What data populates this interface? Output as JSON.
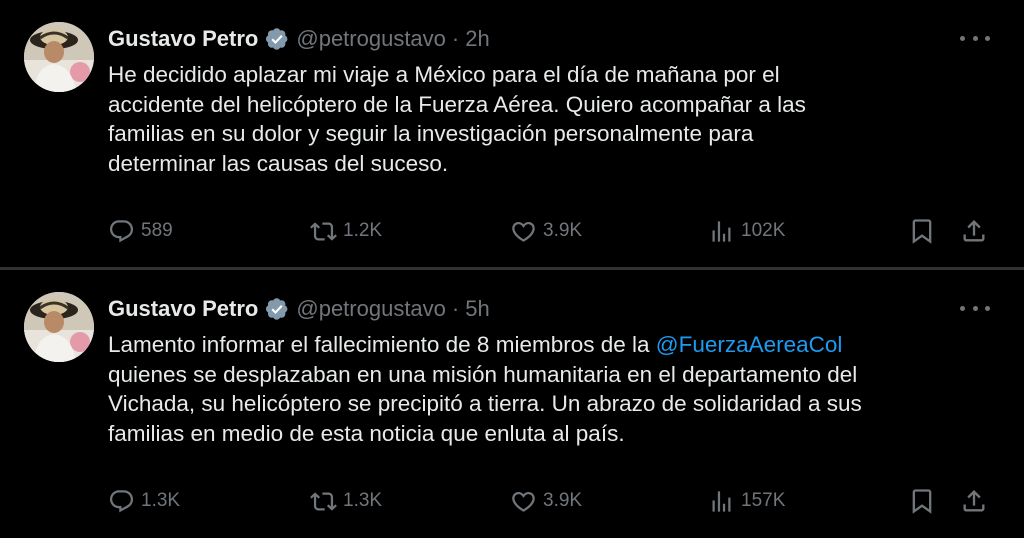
{
  "colors": {
    "background": "#000000",
    "text_primary": "#e7e9ea",
    "text_secondary": "#71767b",
    "link": "#1d9bf0",
    "verified_badge": "#829aab",
    "divider": "#2f3336"
  },
  "tweets": [
    {
      "author": {
        "name": "Gustavo Petro",
        "handle": "@petrogustavo",
        "verified_icon": "verified-badge-icon"
      },
      "separator": "·",
      "time": "2h",
      "text_lines": [
        "He decidido aplazar mi viaje a México para el día de mañana por el",
        "accidente del helicóptero de la Fuerza Aérea. Quiero acompañar a las",
        "familias en su dolor y seguir la investigación personalmente para",
        "determinar las causas del suceso."
      ],
      "metrics": {
        "replies": "589",
        "reposts": "1.2K",
        "likes": "3.9K",
        "views": "102K"
      }
    },
    {
      "author": {
        "name": "Gustavo Petro",
        "handle": "@petrogustavo",
        "verified_icon": "verified-badge-icon"
      },
      "separator": "·",
      "time": "5h",
      "text_line1_prefix": "Lamento informar el fallecimiento de 8 miembros de la ",
      "mention": "@FuerzaAereaCol",
      "text_lines": [
        "quienes se desplazaban en una misión humanitaria en el departamento del",
        "Vichada, su helicóptero se precipitó a tierra. Un abrazo de solidaridad a sus",
        "familias en medio de esta noticia que enluta al país."
      ],
      "metrics": {
        "replies": "1.3K",
        "reposts": "1.3K",
        "likes": "3.9K",
        "views": "157K"
      }
    }
  ]
}
